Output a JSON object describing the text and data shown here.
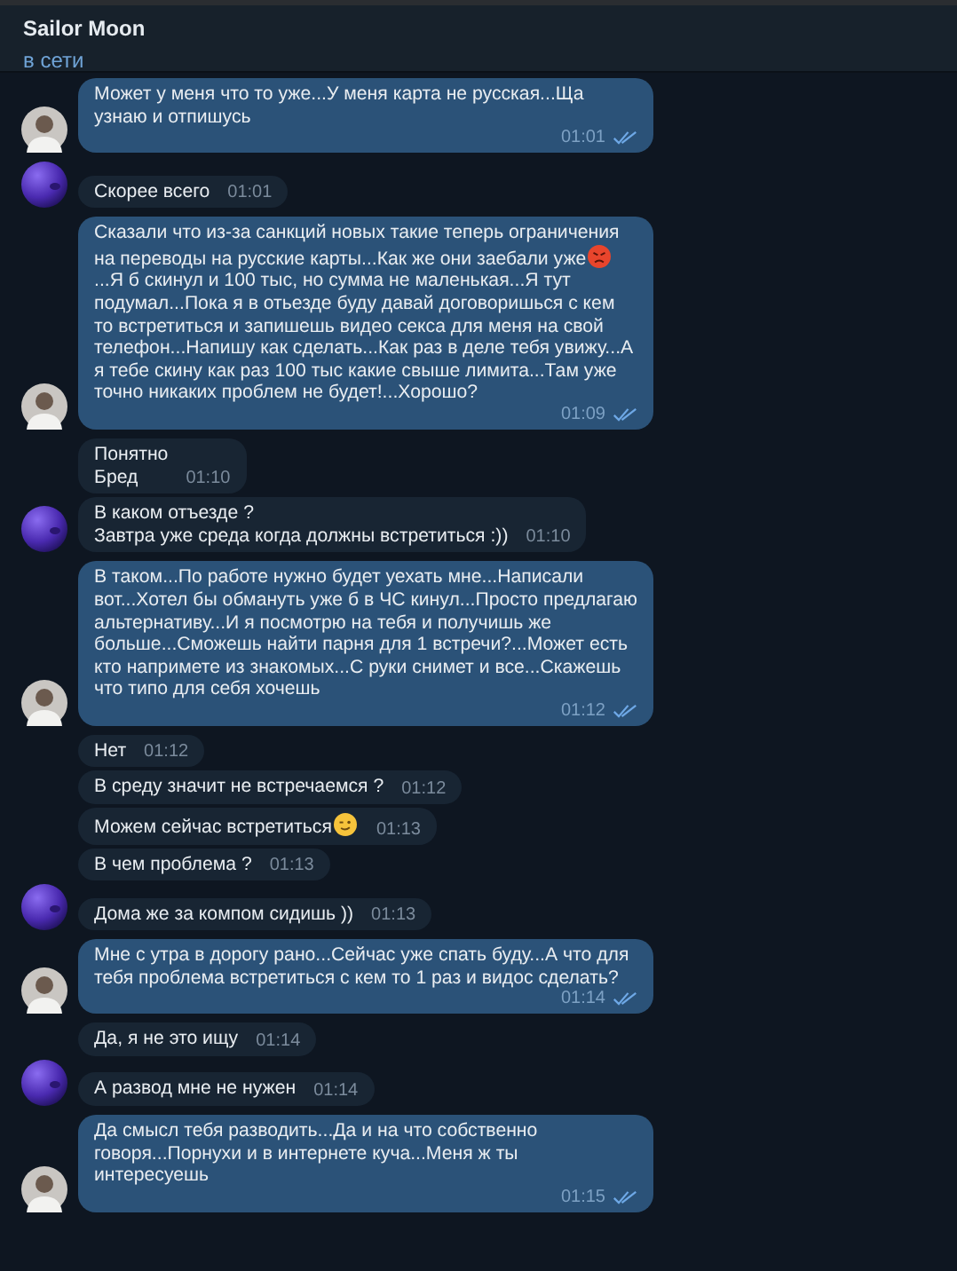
{
  "header": {
    "title": "Sailor Moon",
    "status": "в сети"
  },
  "messages": [
    {
      "kind": "outgoing",
      "avatar": true,
      "read": true,
      "time": "01:01",
      "parts": [
        {
          "kind": "text",
          "text": "Может у меня что то уже...У меня карта не русская...Ща узнаю и отпишусь"
        }
      ]
    },
    {
      "kind": "incoming",
      "avatar": true,
      "time": "01:01",
      "parts": [
        {
          "kind": "text",
          "text": "Скорее всего"
        }
      ]
    },
    {
      "kind": "outgoing",
      "avatar": true,
      "read": true,
      "time": "01:09",
      "parts": [
        {
          "kind": "text",
          "text": "Сказали что из-за санкций новых такие теперь ограничения на переводы на русские карты...Как же они заебали уже"
        },
        {
          "kind": "angry-emoji"
        },
        {
          "kind": "text",
          "text": "...Я б скинул и 100 тыс, но сумма не маленькая...Я тут подумал...Пока я в отьезде буду давай договоришься с кем то встретиться и запишешь видео секса для меня на свой телефон...Напишу как сделать...Как раз в деле тебя увижу...А я тебе скину как раз 100 тыс какие свыше лимита...Там уже точно никаких проблем не будет!...Хорошо?"
        }
      ]
    },
    {
      "kind": "incoming",
      "avatar": false,
      "time": "01:10",
      "parts": [
        {
          "kind": "text",
          "text": "Понятно\nБред"
        }
      ]
    },
    {
      "kind": "incoming",
      "avatar": true,
      "time": "01:10",
      "parts": [
        {
          "kind": "text",
          "text": "В каком отъезде ?\nЗавтра уже среда когда должны встретиться :))"
        }
      ]
    },
    {
      "kind": "outgoing",
      "avatar": true,
      "read": true,
      "time": "01:12",
      "parts": [
        {
          "kind": "text",
          "text": "В таком...По работе нужно будет уехать мне...Написали вот...Хотел бы обмануть уже б в ЧС кинул...Просто предлагаю альтернативу...И я посмотрю на тебя и получишь же больше...Сможешь найти парня для 1 встречи?...Может есть кто напримете из знакомых...С руки снимет и все...Скажешь что типо для себя хочешь"
        }
      ]
    },
    {
      "kind": "incoming",
      "avatar": false,
      "time": "01:12",
      "parts": [
        {
          "kind": "text",
          "text": "Нет"
        }
      ]
    },
    {
      "kind": "incoming",
      "avatar": false,
      "time": "01:12",
      "parts": [
        {
          "kind": "text",
          "text": "В среду значит не встречаемся ?"
        }
      ]
    },
    {
      "kind": "incoming",
      "avatar": false,
      "time": "01:13",
      "parts": [
        {
          "kind": "text",
          "text": "Можем сейчас встретиться"
        },
        {
          "kind": "wink-emoji"
        }
      ]
    },
    {
      "kind": "incoming",
      "avatar": false,
      "time": "01:13",
      "parts": [
        {
          "kind": "text",
          "text": "В чем проблема ?"
        }
      ]
    },
    {
      "kind": "incoming",
      "avatar": true,
      "time": "01:13",
      "parts": [
        {
          "kind": "text",
          "text": "Дома же за компом сидишь ))"
        }
      ]
    },
    {
      "kind": "outgoing",
      "avatar": true,
      "read": true,
      "time": "01:14",
      "parts": [
        {
          "kind": "text",
          "text": "Мне с утра в дорогу рано...Сейчас уже спать буду...А что для тебя проблема встретиться с кем то 1 раз и видос сделать?"
        }
      ]
    },
    {
      "kind": "incoming",
      "avatar": false,
      "time": "01:14",
      "parts": [
        {
          "kind": "text",
          "text": "Да, я не это ищу"
        }
      ]
    },
    {
      "kind": "incoming",
      "avatar": true,
      "time": "01:14",
      "parts": [
        {
          "kind": "text",
          "text": "А развод мне не нужен"
        }
      ]
    },
    {
      "kind": "outgoing",
      "avatar": true,
      "read": true,
      "time": "01:15",
      "parts": [
        {
          "kind": "text",
          "text": "Да смысл тебя разводить...Да и на что собственно говоря...Порнухи и в интернете куча...Меня ж ты интересуешь"
        }
      ]
    }
  ]
}
